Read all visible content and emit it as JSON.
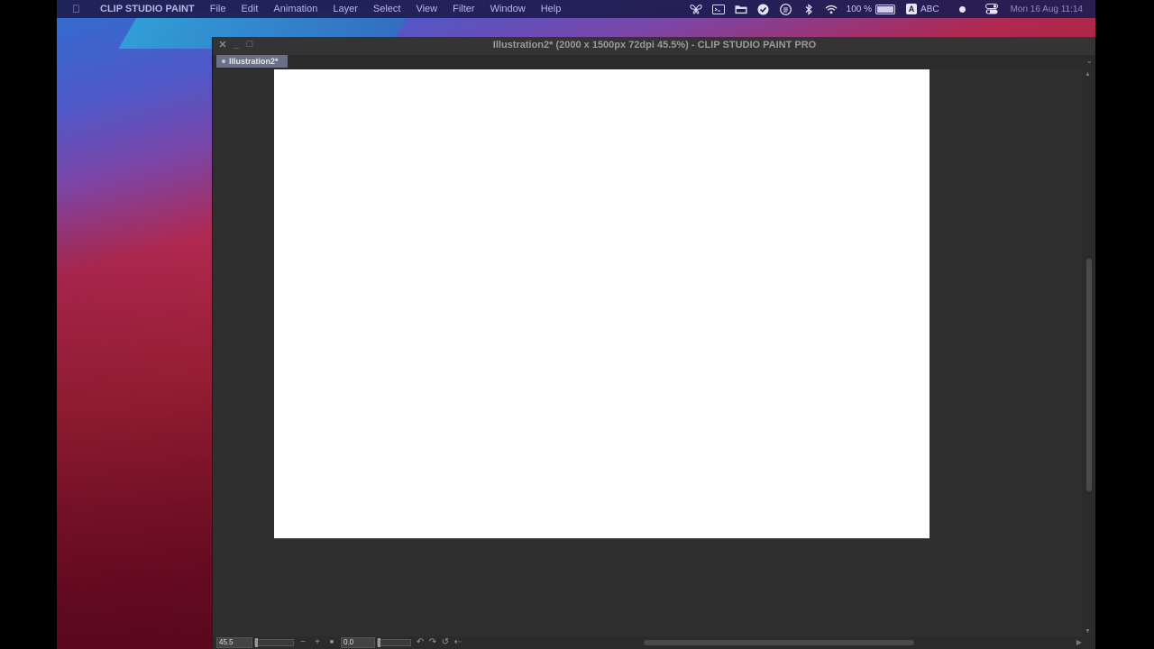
{
  "menubar": {
    "apple_icon": "apple-logo-icon",
    "app_name": "CLIP STUDIO PAINT",
    "menus": [
      "File",
      "Edit",
      "Animation",
      "Layer",
      "Select",
      "View",
      "Filter",
      "Window",
      "Help"
    ],
    "battery_percent": "100 %",
    "battery_level": 1.0,
    "input_source": "ABC",
    "input_source_badge": "A",
    "clock": "Mon 16 Aug  11:14",
    "status_icons": [
      "butterfly-icon",
      "screen-capture-icon",
      "folder-icon",
      "checkmark-circle-icon",
      "list-circle-icon",
      "bluetooth-icon",
      "wifi-icon"
    ]
  },
  "window": {
    "title": "Illustration2* (2000 x 1500px 72dpi 45.5%)  - CLIP STUDIO PAINT PRO",
    "tab_label": "Illustration2*",
    "canvas_bg": "#2f2f2f",
    "paper_color": "#ffffff"
  },
  "statusbar": {
    "zoom_value": "45.5",
    "rotation_value": "0.0",
    "zoom_out": "−",
    "zoom_in": "+"
  }
}
